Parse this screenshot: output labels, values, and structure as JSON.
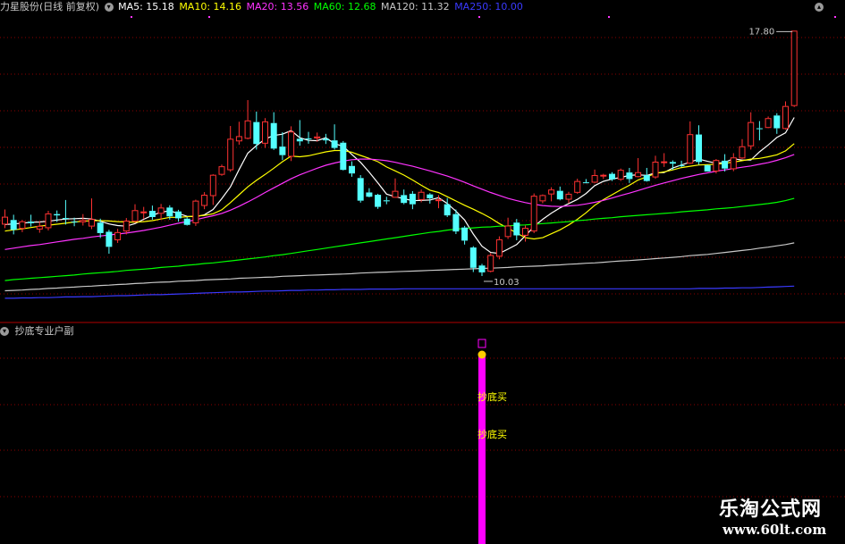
{
  "window": {
    "title": "力星股份(日线 前复权)",
    "collapse_icon": "chevron-down-icon",
    "maximize_icon": "chevron-up-icon"
  },
  "legend": [
    {
      "label": "MA5: 15.18",
      "color": "#ffffff"
    },
    {
      "label": "MA10: 14.16",
      "color": "#ffff00"
    },
    {
      "label": "MA20: 13.56",
      "color": "#ff33ff"
    },
    {
      "label": "MA60: 12.68",
      "color": "#00ff00"
    },
    {
      "label": "MA120: 11.32",
      "color": "#c8c8c8"
    },
    {
      "label": "MA250: 10.00",
      "color": "#3a3aff"
    }
  ],
  "price_panel": {
    "high_marker": "17.80",
    "low_marker": "10.03",
    "ylim": [
      9.0,
      18.3
    ],
    "colors": {
      "up": "#ff3232",
      "down": "#54ffff",
      "grid": "#8b0000",
      "border": "#b00000"
    }
  },
  "indicator_panel": {
    "title": "抄底专业户副",
    "signal_labels": [
      "抄底买",
      "抄底买"
    ],
    "bar_color": "#ff00ff",
    "dot_color": "#ffcc00"
  },
  "watermark": {
    "main": "乐淘公式网",
    "url": "www.60lt.com"
  },
  "chart_data": {
    "type": "candlestick",
    "ylim": [
      9.0,
      18.3
    ],
    "candles": [
      [
        11.88,
        12.12,
        12.34,
        11.77
      ],
      [
        12.02,
        11.72,
        12.18,
        11.58
      ],
      [
        11.75,
        11.98,
        12.02,
        11.65
      ],
      [
        11.97,
        11.92,
        12.18,
        11.82
      ],
      [
        11.73,
        11.84,
        11.97,
        11.63
      ],
      [
        11.77,
        12.22,
        12.3,
        11.7
      ],
      [
        12.2,
        12.16,
        12.31,
        11.96
      ],
      [
        12.08,
        12.07,
        12.63,
        11.88
      ],
      [
        11.97,
        11.96,
        12.09,
        11.83
      ],
      [
        11.95,
        12.02,
        12.2,
        11.85
      ],
      [
        11.82,
        12.05,
        12.68,
        11.74
      ],
      [
        11.94,
        11.62,
        12.06,
        11.47
      ],
      [
        11.66,
        11.2,
        11.72,
        10.99
      ],
      [
        11.4,
        11.65,
        11.75,
        11.32
      ],
      [
        11.67,
        12.0,
        12.08,
        11.58
      ],
      [
        11.97,
        12.32,
        12.5,
        11.93
      ],
      [
        12.28,
        12.28,
        12.42,
        12.05
      ],
      [
        12.3,
        12.11,
        12.46,
        12.03
      ],
      [
        12.21,
        12.4,
        12.51,
        12.03
      ],
      [
        12.4,
        12.13,
        12.47,
        12.03
      ],
      [
        12.28,
        12.07,
        12.33,
        11.97
      ],
      [
        12.06,
        11.87,
        12.11,
        11.85
      ],
      [
        11.92,
        12.61,
        12.64,
        11.84
      ],
      [
        12.45,
        12.79,
        12.87,
        12.35
      ],
      [
        12.75,
        13.4,
        13.42,
        12.48
      ],
      [
        13.4,
        13.66,
        13.71,
        13.37
      ],
      [
        13.54,
        14.5,
        14.89,
        13.49
      ],
      [
        14.42,
        14.58,
        15.02,
        14.32
      ],
      [
        14.5,
        15.06,
        15.68,
        14.48
      ],
      [
        15.01,
        14.34,
        15.33,
        14.17
      ],
      [
        14.35,
        15.03,
        15.13,
        14.22
      ],
      [
        14.98,
        14.2,
        15.31,
        14.16
      ],
      [
        14.26,
        14.0,
        14.7,
        13.85
      ],
      [
        13.95,
        14.72,
        14.88,
        13.82
      ],
      [
        14.5,
        14.42,
        15.07,
        14.29
      ],
      [
        14.51,
        14.5,
        14.71,
        14.35
      ],
      [
        14.51,
        14.57,
        14.69,
        14.41
      ],
      [
        14.5,
        14.45,
        14.65,
        14.34
      ],
      [
        14.45,
        14.22,
        14.94,
        14.17
      ],
      [
        14.38,
        13.55,
        14.43,
        13.53
      ],
      [
        13.67,
        13.44,
        13.81,
        13.34
      ],
      [
        13.3,
        12.61,
        13.39,
        12.55
      ],
      [
        12.86,
        12.73,
        12.99,
        12.71
      ],
      [
        12.79,
        12.42,
        12.82,
        12.36
      ],
      [
        12.62,
        12.59,
        12.73,
        12.5
      ],
      [
        12.7,
        12.91,
        13.29,
        12.74
      ],
      [
        12.78,
        12.54,
        12.95,
        12.5
      ],
      [
        12.82,
        12.5,
        12.9,
        12.35
      ],
      [
        12.63,
        12.88,
        12.95,
        12.56
      ],
      [
        12.8,
        12.68,
        12.84,
        12.52
      ],
      [
        12.65,
        12.65,
        12.78,
        12.38
      ],
      [
        12.5,
        12.16,
        12.69,
        12.11
      ],
      [
        12.2,
        11.67,
        12.34,
        11.59
      ],
      [
        11.79,
        11.39,
        11.84,
        11.27
      ],
      [
        11.18,
        10.56,
        11.22,
        10.43
      ],
      [
        10.63,
        10.42,
        10.68,
        10.31
      ],
      [
        10.44,
        10.95,
        11.01,
        10.42
      ],
      [
        10.9,
        11.43,
        11.52,
        10.82
      ],
      [
        11.5,
        11.85,
        12.09,
        11.44
      ],
      [
        11.94,
        11.55,
        12.05,
        11.4
      ],
      [
        11.54,
        11.78,
        11.85,
        11.36
      ],
      [
        11.67,
        12.76,
        12.83,
        11.62
      ],
      [
        12.59,
        12.78,
        12.8,
        12.53
      ],
      [
        12.8,
        12.95,
        13.02,
        12.59
      ],
      [
        12.91,
        12.65,
        13.04,
        12.62
      ],
      [
        12.64,
        12.82,
        12.88,
        12.53
      ],
      [
        12.85,
        13.21,
        13.28,
        12.82
      ],
      [
        13.17,
        13.16,
        13.27,
        13.15
      ],
      [
        13.16,
        13.39,
        13.56,
        13.15
      ],
      [
        13.39,
        13.4,
        13.43,
        13.27
      ],
      [
        13.43,
        13.26,
        13.48,
        13.21
      ],
      [
        13.25,
        13.55,
        13.59,
        13.21
      ],
      [
        13.47,
        13.27,
        13.61,
        13.15
      ],
      [
        13.33,
        13.48,
        13.91,
        13.32
      ],
      [
        13.39,
        13.21,
        13.61,
        13.19
      ],
      [
        13.32,
        13.8,
        13.98,
        13.28
      ],
      [
        13.8,
        13.81,
        14.06,
        13.64
      ],
      [
        13.79,
        13.74,
        13.84,
        13.55
      ],
      [
        13.69,
        13.67,
        13.83,
        13.63
      ],
      [
        13.74,
        14.64,
        15.03,
        13.73
      ],
      [
        14.63,
        13.79,
        14.91,
        13.71
      ],
      [
        13.69,
        13.5,
        13.71,
        13.5
      ],
      [
        13.5,
        13.85,
        13.88,
        13.44
      ],
      [
        13.83,
        13.59,
        14.03,
        13.5
      ],
      [
        13.57,
        13.93,
        14.06,
        13.51
      ],
      [
        13.9,
        14.27,
        14.49,
        13.88
      ],
      [
        14.27,
        15.01,
        15.31,
        14.17
      ],
      [
        14.82,
        14.8,
        15.04,
        14.45
      ],
      [
        14.83,
        15.13,
        15.18,
        14.82
      ],
      [
        15.21,
        14.82,
        15.28,
        14.65
      ],
      [
        14.8,
        15.5,
        15.64,
        14.78
      ],
      [
        15.5,
        17.8,
        17.8,
        15.47
      ]
    ],
    "series": [
      {
        "name": "MA5",
        "color": "#ffffff",
        "values": [
          11.88,
          11.9,
          11.92,
          11.95,
          11.96,
          11.98,
          12.02,
          12.05,
          12.06,
          12.07,
          12.05,
          11.98,
          11.9,
          11.85,
          11.83,
          11.91,
          12.04,
          12.16,
          12.26,
          12.3,
          12.22,
          12.13,
          12.12,
          12.18,
          12.34,
          12.67,
          13.03,
          13.56,
          14.06,
          14.29,
          14.49,
          14.6,
          14.64,
          14.75,
          14.53,
          14.45,
          14.44,
          14.53,
          14.35,
          14.27,
          14.02,
          13.78,
          13.48,
          13.15,
          12.81,
          12.73,
          12.67,
          12.61,
          12.62,
          12.63,
          12.7,
          12.52,
          12.29,
          12.02,
          11.59,
          11.22,
          11.03,
          11.0,
          11.13,
          11.27,
          11.54,
          11.82,
          12.04,
          12.23,
          12.39,
          12.52,
          12.65,
          12.83,
          13.07,
          13.2,
          13.27,
          13.32,
          13.38,
          13.4,
          13.38,
          13.46,
          13.47,
          13.61,
          13.7,
          13.79,
          13.88,
          13.81,
          13.75,
          13.78,
          13.89,
          13.85,
          13.85,
          14.1,
          14.31,
          14.54,
          14.68,
          15.15
        ]
      },
      {
        "name": "MA10",
        "color": "#ffff00",
        "values": [
          11.68,
          11.72,
          11.75,
          11.79,
          11.83,
          11.86,
          11.89,
          11.92,
          11.96,
          11.98,
          12.0,
          12.0,
          11.99,
          11.97,
          11.96,
          11.95,
          11.97,
          12.0,
          12.05,
          12.1,
          12.1,
          12.12,
          12.14,
          12.16,
          12.21,
          12.33,
          12.55,
          12.79,
          13.03,
          13.23,
          13.41,
          13.6,
          13.8,
          13.97,
          13.95,
          13.98,
          14.04,
          14.1,
          14.14,
          14.14,
          14.09,
          13.99,
          13.9,
          13.8,
          13.64,
          13.52,
          13.39,
          13.24,
          13.08,
          12.93,
          12.86,
          12.73,
          12.6,
          12.47,
          12.35,
          12.22,
          12.08,
          11.91,
          11.77,
          11.62,
          11.48,
          11.44,
          11.48,
          11.6,
          11.72,
          11.87,
          12.04,
          12.24,
          12.47,
          12.64,
          12.79,
          12.94,
          13.08,
          13.24,
          13.34,
          13.44,
          13.49,
          13.55,
          13.62,
          13.66,
          13.7,
          13.71,
          13.72,
          13.75,
          13.79,
          13.83,
          13.88,
          13.9,
          13.95,
          14.01,
          14.13,
          14.35
        ]
      },
      {
        "name": "MA20",
        "color": "#ff33ff",
        "values": [
          11.12,
          11.16,
          11.2,
          11.24,
          11.27,
          11.31,
          11.35,
          11.39,
          11.43,
          11.46,
          11.5,
          11.53,
          11.56,
          11.59,
          11.62,
          11.66,
          11.7,
          11.75,
          11.8,
          11.86,
          11.92,
          11.97,
          12.03,
          12.09,
          12.15,
          12.22,
          12.32,
          12.44,
          12.57,
          12.71,
          12.86,
          13.0,
          13.14,
          13.28,
          13.4,
          13.5,
          13.6,
          13.69,
          13.76,
          13.82,
          13.86,
          13.88,
          13.88,
          13.86,
          13.83,
          13.78,
          13.72,
          13.66,
          13.59,
          13.52,
          13.44,
          13.36,
          13.27,
          13.17,
          13.06,
          12.96,
          12.86,
          12.77,
          12.68,
          12.61,
          12.55,
          12.5,
          12.46,
          12.44,
          12.43,
          12.45,
          12.47,
          12.51,
          12.56,
          12.62,
          12.69,
          12.77,
          12.84,
          12.92,
          13.0,
          13.08,
          13.15,
          13.22,
          13.29,
          13.35,
          13.41,
          13.46,
          13.51,
          13.55,
          13.59,
          13.63,
          13.67,
          13.72,
          13.77,
          13.84,
          13.92,
          14.02
        ]
      },
      {
        "name": "MA60",
        "color": "#00ff00",
        "values": [
          10.17,
          10.2,
          10.22,
          10.24,
          10.26,
          10.28,
          10.3,
          10.32,
          10.34,
          10.37,
          10.39,
          10.41,
          10.43,
          10.45,
          10.48,
          10.5,
          10.52,
          10.54,
          10.57,
          10.59,
          10.61,
          10.64,
          10.66,
          10.69,
          10.71,
          10.74,
          10.77,
          10.8,
          10.83,
          10.86,
          10.89,
          10.93,
          10.96,
          11.0,
          11.04,
          11.08,
          11.12,
          11.16,
          11.2,
          11.24,
          11.28,
          11.32,
          11.36,
          11.4,
          11.44,
          11.48,
          11.52,
          11.56,
          11.6,
          11.64,
          11.67,
          11.71,
          11.74,
          11.76,
          11.78,
          11.8,
          11.81,
          11.83,
          11.84,
          11.86,
          11.87,
          11.89,
          11.91,
          11.93,
          11.95,
          11.97,
          12.0,
          12.02,
          12.05,
          12.07,
          12.09,
          12.12,
          12.14,
          12.16,
          12.18,
          12.2,
          12.22,
          12.24,
          12.27,
          12.29,
          12.31,
          12.33,
          12.36,
          12.38,
          12.4,
          12.43,
          12.46,
          12.49,
          12.52,
          12.56,
          12.61,
          12.68
        ]
      },
      {
        "name": "MA120",
        "color": "#c8c8c8",
        "values": [
          9.86,
          9.87,
          9.88,
          9.9,
          9.91,
          9.93,
          9.94,
          9.96,
          9.97,
          9.99,
          10.0,
          10.02,
          10.03,
          10.05,
          10.06,
          10.08,
          10.09,
          10.11,
          10.12,
          10.13,
          10.15,
          10.16,
          10.17,
          10.19,
          10.2,
          10.21,
          10.22,
          10.24,
          10.25,
          10.26,
          10.27,
          10.28,
          10.3,
          10.31,
          10.32,
          10.33,
          10.34,
          10.35,
          10.36,
          10.37,
          10.38,
          10.4,
          10.41,
          10.42,
          10.43,
          10.44,
          10.45,
          10.46,
          10.47,
          10.48,
          10.49,
          10.5,
          10.51,
          10.52,
          10.53,
          10.54,
          10.55,
          10.56,
          10.57,
          10.59,
          10.6,
          10.61,
          10.62,
          10.64,
          10.65,
          10.67,
          10.68,
          10.7,
          10.71,
          10.73,
          10.75,
          10.77,
          10.78,
          10.8,
          10.82,
          10.84,
          10.86,
          10.88,
          10.9,
          10.93,
          10.95,
          10.97,
          11.0,
          11.03,
          11.06,
          11.09,
          11.12,
          11.16,
          11.19,
          11.23,
          11.27,
          11.32
        ]
      },
      {
        "name": "MA250",
        "color": "#3a3aff",
        "values": [
          9.63,
          9.63,
          9.64,
          9.64,
          9.65,
          9.65,
          9.66,
          9.67,
          9.67,
          9.68,
          9.68,
          9.69,
          9.7,
          9.71,
          9.71,
          9.72,
          9.73,
          9.74,
          9.74,
          9.75,
          9.76,
          9.77,
          9.78,
          9.79,
          9.8,
          9.81,
          9.82,
          9.82,
          9.83,
          9.84,
          9.85,
          9.85,
          9.86,
          9.87,
          9.87,
          9.88,
          9.88,
          9.89,
          9.89,
          9.9,
          9.9,
          9.9,
          9.91,
          9.91,
          9.91,
          9.91,
          9.92,
          9.92,
          9.92,
          9.92,
          9.92,
          9.92,
          9.92,
          9.92,
          9.92,
          9.92,
          9.92,
          9.92,
          9.92,
          9.92,
          9.92,
          9.92,
          9.92,
          9.92,
          9.92,
          9.92,
          9.92,
          9.92,
          9.92,
          9.92,
          9.92,
          9.92,
          9.92,
          9.92,
          9.92,
          9.92,
          9.92,
          9.92,
          9.92,
          9.92,
          9.93,
          9.93,
          9.93,
          9.94,
          9.94,
          9.95,
          9.95,
          9.96,
          9.97,
          9.98,
          9.99,
          10.0
        ]
      }
    ],
    "signal_index": 55
  }
}
